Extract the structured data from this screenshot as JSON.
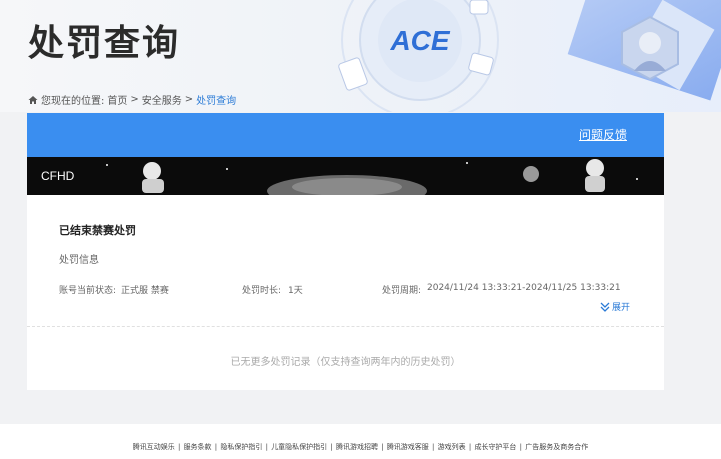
{
  "header": {
    "title": "处罚查询",
    "logo_text": "ACE"
  },
  "breadcrumb": {
    "prefix": "您现在的位置:",
    "items": [
      "首页",
      "安全服务",
      "处罚查询"
    ],
    "separator": ">"
  },
  "card": {
    "feedback_label": "问题反馈",
    "banner_label": "CFHD",
    "ban_title": "已结束禁赛处罚",
    "section_label": "处罚信息",
    "status_label": "账号当前状态:",
    "status_value": "正式服 禁赛",
    "duration_label": "处罚时长:",
    "duration_value": "1天",
    "period_label": "处罚周期:",
    "period_value": "2024/11/24 13:33:21-2024/11/25 13:33:21",
    "expand_label": "展开",
    "no_more": "已无更多处罚记录（仅支持查询两年内的历史处罚）"
  },
  "footer": {
    "links": [
      "腾讯互动娱乐",
      "服务条款",
      "隐私保护指引",
      "儿童隐私保护指引",
      "腾讯游戏招聘",
      "腾讯游戏客服",
      "游戏列表",
      "成长守护平台",
      "广告服务及商务合作"
    ]
  },
  "colors": {
    "accent": "#3a8ef0",
    "link": "#2a7ad6",
    "banner_bg": "#0b0b0b"
  }
}
